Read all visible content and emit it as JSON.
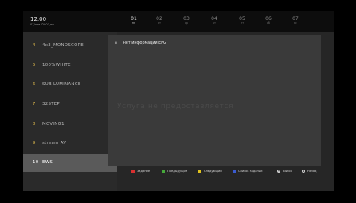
{
  "header": {
    "time": "12.00",
    "date": "07/янв./2007,пн"
  },
  "days": [
    {
      "num": "01",
      "wd": "пн",
      "selected": true
    },
    {
      "num": "02",
      "wd": "вт"
    },
    {
      "num": "03",
      "wd": "ср"
    },
    {
      "num": "04",
      "wd": "чт"
    },
    {
      "num": "05",
      "wd": "пт"
    },
    {
      "num": "06",
      "wd": "сб"
    },
    {
      "num": "07",
      "wd": "вс"
    }
  ],
  "channels": [
    {
      "num": "4",
      "name": "4x3_MONOSCOPE"
    },
    {
      "num": "5",
      "name": "100%WHITE"
    },
    {
      "num": "6",
      "name": "SUB LUMINANCE"
    },
    {
      "num": "7",
      "name": "32STEP"
    },
    {
      "num": "8",
      "name": "MOVING1"
    },
    {
      "num": "9",
      "name": "stream AV"
    },
    {
      "num": "10",
      "name": "EWS",
      "selected": true
    }
  ],
  "epg": {
    "message": "нет информации EPG",
    "watermark": "Услуга не предоставляется"
  },
  "footer": [
    {
      "label": "Задание",
      "color": "#d83030"
    },
    {
      "label": "Предыдущий",
      "color": "#46a83a"
    },
    {
      "label": "Следующий",
      "color": "#e0c21e"
    },
    {
      "label": "Список заданий",
      "color": "#3a5bd0"
    },
    {
      "label": "Выбор",
      "icon": "ok-icon"
    },
    {
      "label": "Назад",
      "icon": "back-icon"
    }
  ]
}
